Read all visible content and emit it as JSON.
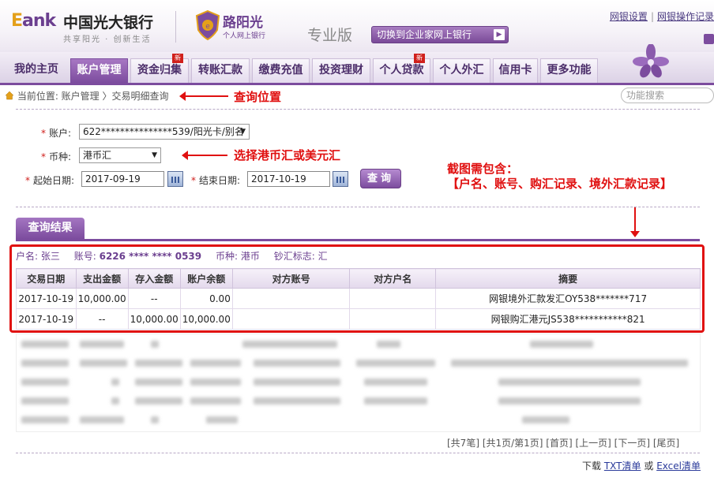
{
  "brand": {
    "eank": "Eank",
    "bank_name": "中国光大银行",
    "slogan": "共享阳光 · 创新生活",
    "lyg_title": "路阳光",
    "lyg_sub": "个人网上银行",
    "edition": "专业版",
    "switch_label": "切换到企业家网上银行"
  },
  "top_links": [
    "网银设置",
    "网银操作记录"
  ],
  "nav": {
    "items": [
      {
        "label": "我的主页",
        "new": false
      },
      {
        "label": "账户管理",
        "new": false
      },
      {
        "label": "资金归集",
        "new": true
      },
      {
        "label": "转账汇款",
        "new": false
      },
      {
        "label": "缴费充值",
        "new": false
      },
      {
        "label": "投资理财",
        "new": false
      },
      {
        "label": "个人贷款",
        "new": true
      },
      {
        "label": "个人外汇",
        "new": false
      },
      {
        "label": "信用卡",
        "new": false
      },
      {
        "label": "更多功能",
        "new": false
      }
    ],
    "new_label": "新"
  },
  "breadcrumb": {
    "text": "当前位置: 账户管理 〉交易明细查询"
  },
  "search": {
    "placeholder": "功能搜索"
  },
  "annotations": {
    "query_position": "查询位置",
    "choose_currency": "选择港币汇或美元汇",
    "screenshot_need_line1": "截图需包含：",
    "screenshot_need_line2": "【户名、账号、购汇记录、境外汇款记录】"
  },
  "form": {
    "account_label": "账户:",
    "account_value": "622***************539/阳光卡/别名",
    "currency_label": "币种:",
    "currency_value": "港币汇",
    "start_label": "起始日期:",
    "start_value": "2017-09-19",
    "end_label": "结束日期:",
    "end_value": "2017-10-19",
    "query_label": "查询"
  },
  "results": {
    "tab_label": "查询结果",
    "name_label": "户名:",
    "name_value": "张三",
    "acct_label": "账号:",
    "acct_value": "6226 **** **** 0539",
    "currency_label": "币种:",
    "currency_value": "港币",
    "flag_label": "钞汇标志:",
    "flag_value": "汇",
    "columns": [
      "交易日期",
      "支出金额",
      "存入金额",
      "账户余额",
      "对方账号",
      "对方户名",
      "摘要"
    ],
    "rows": [
      [
        "2017-10-19",
        "10,000.00",
        "--",
        "0.00",
        "",
        "",
        "网银境外汇款发汇OY538*******717"
      ],
      [
        "2017-10-19",
        "--",
        "10,000.00",
        "10,000.00",
        "",
        "",
        "网银购汇港元JS538***********821"
      ]
    ]
  },
  "pager": {
    "text": "[共7笔] [共1页/第1页] [首页] [上一页] [下一页] [尾页]"
  },
  "download": {
    "prefix": "下载",
    "txt": "TXT清单",
    "or": "或",
    "excel": "Excel清单"
  }
}
